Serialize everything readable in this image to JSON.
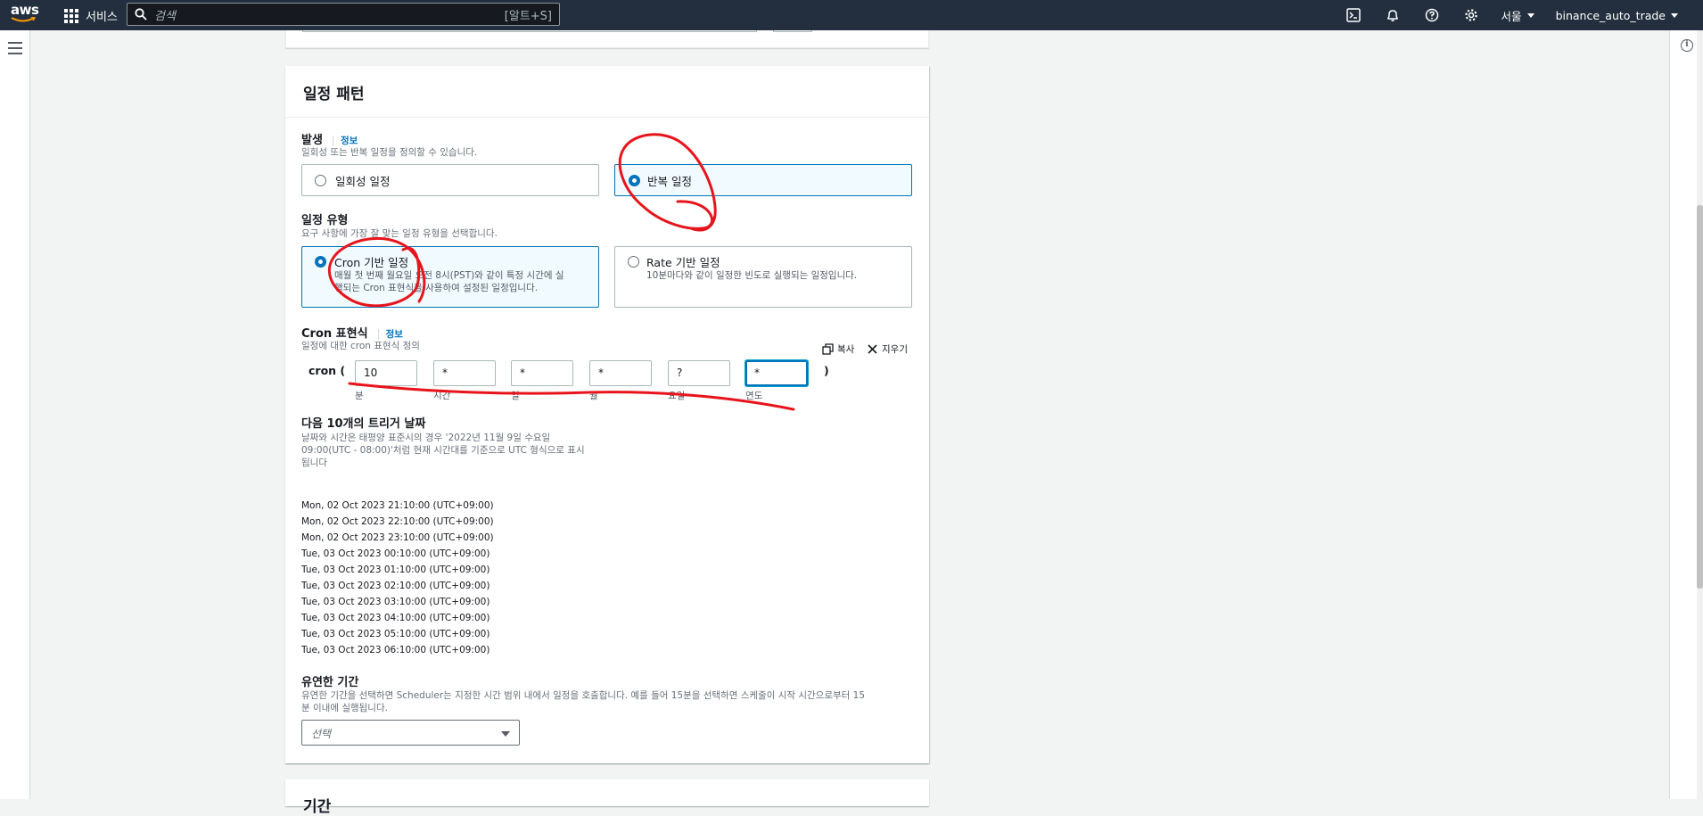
{
  "topnav": {
    "logo": "aws",
    "services_label": "서비스",
    "search_placeholder": "검색",
    "search_shortcut": "[알트+S]",
    "region": "서울",
    "account": "binance_auto_trade"
  },
  "section": {
    "title": "일정 패턴",
    "occurrence": {
      "label": "발생",
      "info": "정보",
      "description": "일회성 또는 반복 일정을 정의할 수 있습니다.",
      "options": [
        "일회성 일정",
        "반복 일정"
      ],
      "selected": "반복 일정"
    },
    "schedule_type": {
      "label": "일정 유형",
      "description": "요구 사항에 가장 잘 맞는 일정 유형을 선택합니다.",
      "cron": {
        "title": "Cron 기반 일정",
        "desc_line1": "매월 첫 번째 월요일 오전 8시(PST)와 같이 특정 시간에 실",
        "desc_line2": "행되는 Cron 표현식을 사용하여 설정된 일정입니다."
      },
      "rate": {
        "title": "Rate 기반 일정",
        "desc": "10분마다와 같이 일정한 빈도로 실행되는 일정입니다."
      },
      "selected": "Cron 기반 일정"
    },
    "cron_expression": {
      "label": "Cron 표현식",
      "info": "정보",
      "description": "일정에 대한 cron 표현식 정의",
      "prefix": "cron (",
      "suffix": ")",
      "copy_label": "복사",
      "clear_label": "지우기",
      "fields": [
        {
          "value": "10",
          "label": "분"
        },
        {
          "value": "*",
          "label": "시간"
        },
        {
          "value": "*",
          "label": "일"
        },
        {
          "value": "*",
          "label": "월"
        },
        {
          "value": "?",
          "label": "요일"
        },
        {
          "value": "*",
          "label": "연도"
        }
      ]
    },
    "next_triggers": {
      "label": "다음 10개의 트리거 날짜",
      "desc_line1": "날짜와 시간은 태평양 표준시의 경우 '2022년 11월 9일 수요일",
      "desc_line2": "09:00(UTC - 08:00)'처럼 현재 시간대를 기준으로 UTC 형식으로 표시",
      "desc_line3": "됩니다",
      "dates": [
        "Mon, 02 Oct 2023 21:10:00 (UTC+09:00)",
        "Mon, 02 Oct 2023 22:10:00 (UTC+09:00)",
        "Mon, 02 Oct 2023 23:10:00 (UTC+09:00)",
        "Tue, 03 Oct 2023 00:10:00 (UTC+09:00)",
        "Tue, 03 Oct 2023 01:10:00 (UTC+09:00)",
        "Tue, 03 Oct 2023 02:10:00 (UTC+09:00)",
        "Tue, 03 Oct 2023 03:10:00 (UTC+09:00)",
        "Tue, 03 Oct 2023 04:10:00 (UTC+09:00)",
        "Tue, 03 Oct 2023 05:10:00 (UTC+09:00)",
        "Tue, 03 Oct 2023 06:10:00 (UTC+09:00)"
      ]
    },
    "flex_window": {
      "label": "유연한 기간",
      "desc_line1": "유연한 기간을 선택하면 Scheduler는 지정한 시간 범위 내에서 일정을 호출합니다. 예를 들어 15분을 선택하면 스케줄이 시작 시간으로부터 15",
      "desc_line2": "분 이내에 실행됩니다.",
      "placeholder": "선택"
    }
  },
  "next_section_title": "기간",
  "colors": {
    "nav_bg": "#232f3e",
    "accent": "#0073bb",
    "annotation": "#e8141b"
  }
}
